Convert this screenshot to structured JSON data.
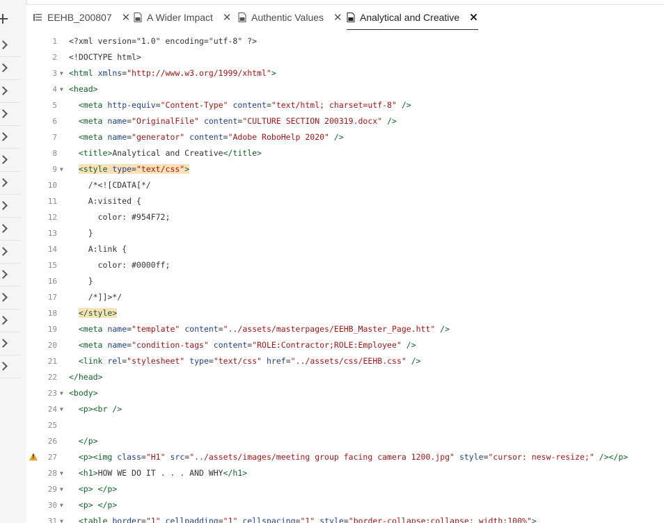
{
  "tabs": [
    {
      "label": "EEHB_200807",
      "icon": "list-icon",
      "active": false
    },
    {
      "label": "A Wider Impact",
      "icon": "html-file-icon",
      "active": false
    },
    {
      "label": "Authentic Values",
      "icon": "html-file-icon",
      "active": false
    },
    {
      "label": "Analytical and Creative",
      "icon": "html-file-icon",
      "active": true
    }
  ],
  "close_glyph": "✕",
  "lines": [
    {
      "n": "1"
    },
    {
      "n": "2"
    },
    {
      "n": "3"
    },
    {
      "n": "4"
    },
    {
      "n": "5"
    },
    {
      "n": "6"
    },
    {
      "n": "7"
    },
    {
      "n": "8"
    },
    {
      "n": "9"
    },
    {
      "n": "10"
    },
    {
      "n": "11"
    },
    {
      "n": "12"
    },
    {
      "n": "13"
    },
    {
      "n": "14"
    },
    {
      "n": "15"
    },
    {
      "n": "16"
    },
    {
      "n": "17"
    },
    {
      "n": "18"
    },
    {
      "n": "19"
    },
    {
      "n": "20"
    },
    {
      "n": "21"
    },
    {
      "n": "22"
    },
    {
      "n": "23"
    },
    {
      "n": "24"
    },
    {
      "n": "25"
    },
    {
      "n": "26"
    },
    {
      "n": "27"
    },
    {
      "n": "28"
    },
    {
      "n": "29"
    },
    {
      "n": "30"
    },
    {
      "n": "31"
    }
  ],
  "code": {
    "l1": "<?xml version=\"1.0\" encoding=\"utf-8\" ?>",
    "l2": "<!DOCTYPE html>",
    "l3_tag": "<html",
    "l3_attr": "xmlns",
    "l3_val": "\"http://www.w3.org/1999/xhtml\"",
    "l4": "<head>",
    "l5_tag": "<meta",
    "l5_a1": "http-equiv",
    "l5_v1": "\"Content-Type\"",
    "l5_a2": "content",
    "l5_v2": "\"text/html; charset=utf-8\"",
    "l6_a1": "name",
    "l6_v1": "\"OriginalFile\"",
    "l6_v2": "\"CULTURE SECTION 200319.docx\"",
    "l7_v1": "\"generator\"",
    "l7_v2": "\"Adobe RoboHelp 2020\"",
    "l8_open": "<title>",
    "l8_text": "Analytical and Creative",
    "l8_close": "</title>",
    "l9_tag": "<style",
    "l9_attr": "type",
    "l9_val": "\"text/css\"",
    "l10": "/*<![CDATA[*/",
    "l11": "A:visited {",
    "l12": "color: #954F72;",
    "l13": "}",
    "l14": "A:link {",
    "l15": "color: #0000ff;",
    "l16": "}",
    "l17": "/*]]>*/",
    "l18": "</style>",
    "l19_v1": "\"template\"",
    "l19_v2": "\"../assets/masterpages/EEHB_Master_Page.htt\"",
    "l20_v1": "\"condition-tags\"",
    "l20_v2": "\"ROLE:Contractor;ROLE:Employee\"",
    "l21_tag": "<link",
    "l21_a1": "rel",
    "l21_v1": "\"stylesheet\"",
    "l21_a2": "type",
    "l21_v2": "\"text/css\"",
    "l21_a3": "href",
    "l21_v3": "\"../assets/css/EEHB.css\"",
    "l22": "</head>",
    "l23": "<body>",
    "l24": "<p><br />",
    "l26": "</p>",
    "l27_pre": "<p><img",
    "l27_a1": "class",
    "l27_v1": "\"H1\"",
    "l27_a2": "src",
    "l27_v2": "\"../assets/images/meeting group facing camera 1200.jpg\"",
    "l27_a3": "style",
    "l27_v3": "\"cursor: nesw-resize;\"",
    "l27_end": "/></p>",
    "l28_open": "<h1>",
    "l28_text": "HOW WE DO IT . . . AND WHY",
    "l28_close": "</h1>",
    "l29": "<p> </p>",
    "l30": "<p> </p>",
    "l31_tag": "<table",
    "l31_a1": "border",
    "l31_v1": "\"1\"",
    "l31_a2": "cellpadding",
    "l31_v2": "\"1\"",
    "l31_a3": "cellspacing",
    "l31_v3": "\"1\"",
    "l31_a4": "style",
    "l31_v4": "\"border-collapse:collapse; width:100%\"",
    "l31_end": ">",
    "gt": ">",
    "selfclose": "/>",
    "eq": "=",
    "meta": "<meta",
    "name": "name",
    "content": "content"
  },
  "colors": {
    "tag": "#116329",
    "attr": "#1f3f8f",
    "string": "#a31515",
    "highlight": "#fbe0b8",
    "warning": "#e8a317"
  }
}
